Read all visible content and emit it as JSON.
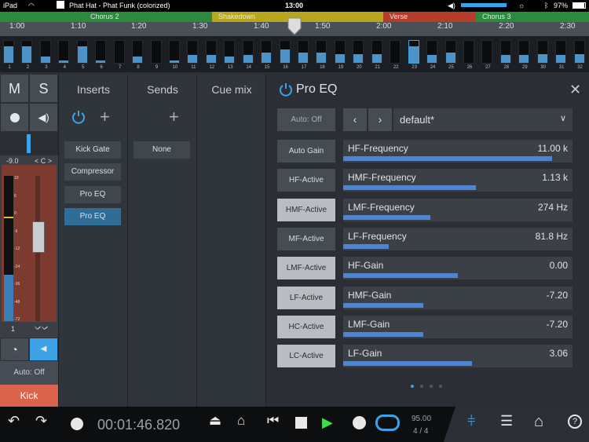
{
  "status": {
    "device": "iPad",
    "title": "Phat Hat - Phat Funk (colorized)",
    "time": "13:00",
    "battery": "97%"
  },
  "sections": [
    {
      "name": "Chorus 2",
      "color": "#2c8a3c"
    },
    {
      "name": "Shakedown",
      "color": "#b8a71c"
    },
    {
      "name": "Verse",
      "color": "#b53d2a"
    },
    {
      "name": "Chorus 3",
      "color": "#2c8a3c"
    }
  ],
  "timeline": [
    "1:00",
    "1:10",
    "1:20",
    "1:30",
    "1:40",
    "1:50",
    "2:00",
    "2:10",
    "2:20",
    "2:30"
  ],
  "strip": {
    "labels": [
      "1",
      "2",
      "3",
      "4",
      "5",
      "6",
      "7",
      "8",
      "9",
      "10",
      "11",
      "12",
      "13",
      "14",
      "15",
      "16",
      "17",
      "18",
      "19",
      "20",
      "21",
      "22",
      "23",
      "24",
      "25",
      "26",
      "27",
      "28",
      "29",
      "30",
      "31",
      "32"
    ],
    "levels": [
      0.75,
      0.75,
      0.3,
      0.1,
      0.75,
      0.1,
      0.0,
      0.3,
      0.0,
      0.1,
      0.35,
      0.35,
      0.3,
      0.35,
      0.45,
      0.6,
      0.45,
      0.45,
      0.4,
      0.4,
      0.4,
      0.0,
      0.75,
      0.35,
      0.45,
      0.0,
      0.0,
      0.35,
      0.35,
      0.4,
      0.35,
      0.4
    ]
  },
  "channel": {
    "mute": "M",
    "solo": "S",
    "volume": "-9.0",
    "pan": "< C >",
    "scale": [
      "10",
      "6",
      "0",
      "-6",
      "-12",
      "-24",
      "-36",
      "-48",
      "-72"
    ],
    "number": "1",
    "automation": "Auto: Off",
    "name": "Kick"
  },
  "inserts": {
    "header": "Inserts",
    "items": [
      "Kick Gate",
      "Compressor",
      "Pro EQ",
      "Pro EQ"
    ]
  },
  "sends": {
    "header": "Sends",
    "items": [
      "None"
    ]
  },
  "cue": {
    "header": "Cue mix"
  },
  "eq": {
    "title": "Pro EQ",
    "automation": "Auto: Off",
    "preset": "default*",
    "buttons": [
      {
        "label": "Auto Gain",
        "on": false
      },
      {
        "label": "HF-Active",
        "on": false
      },
      {
        "label": "HMF-Active",
        "on": true
      },
      {
        "label": "MF-Active",
        "on": false
      },
      {
        "label": "LMF-Active",
        "on": true
      },
      {
        "label": "LF-Active",
        "on": true
      },
      {
        "label": "HC-Active",
        "on": true
      },
      {
        "label": "LC-Active",
        "on": true
      }
    ],
    "params": [
      {
        "name": "HF-Frequency",
        "value": "11.00 k",
        "level": 0.91
      },
      {
        "name": "HMF-Frequency",
        "value": "1.13 k",
        "level": 0.58
      },
      {
        "name": "LMF-Frequency",
        "value": "274 Hz",
        "level": 0.38
      },
      {
        "name": "LF-Frequency",
        "value": "81.8 Hz",
        "level": 0.2
      },
      {
        "name": "HF-Gain",
        "value": "0.00",
        "level": 0.5
      },
      {
        "name": "HMF-Gain",
        "value": "-7.20",
        "level": 0.35
      },
      {
        "name": "LMF-Gain",
        "value": "-7.20",
        "level": 0.35
      },
      {
        "name": "LF-Gain",
        "value": "3.06",
        "level": 0.56
      }
    ]
  },
  "transport": {
    "time": "00:01:46.820",
    "tempo": "95.00",
    "signature": "4 / 4"
  }
}
